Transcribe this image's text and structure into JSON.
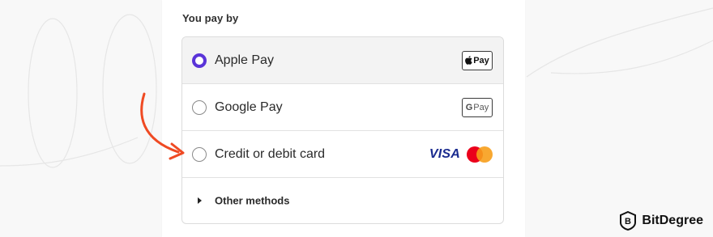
{
  "payment": {
    "heading": "You pay by",
    "options": [
      {
        "label": "Apple Pay",
        "selected": true,
        "badge_icon": "apple-icon",
        "badge_text": "Pay"
      },
      {
        "label": "Google Pay",
        "selected": false,
        "badge_icon": "google-g-icon",
        "badge_text": "Pay"
      },
      {
        "label": "Credit or debit card",
        "selected": false,
        "card_brand": "VISA",
        "card_icon": "mastercard-icon"
      }
    ],
    "other_methods": "Other methods"
  },
  "watermark": {
    "text": "BitDegree"
  },
  "colors": {
    "accent": "#5a34d8",
    "arrow": "#ef4a23",
    "visa": "#1a2b8f",
    "mastercard_red": "#eb001b",
    "mastercard_orange": "#f79e1b"
  }
}
